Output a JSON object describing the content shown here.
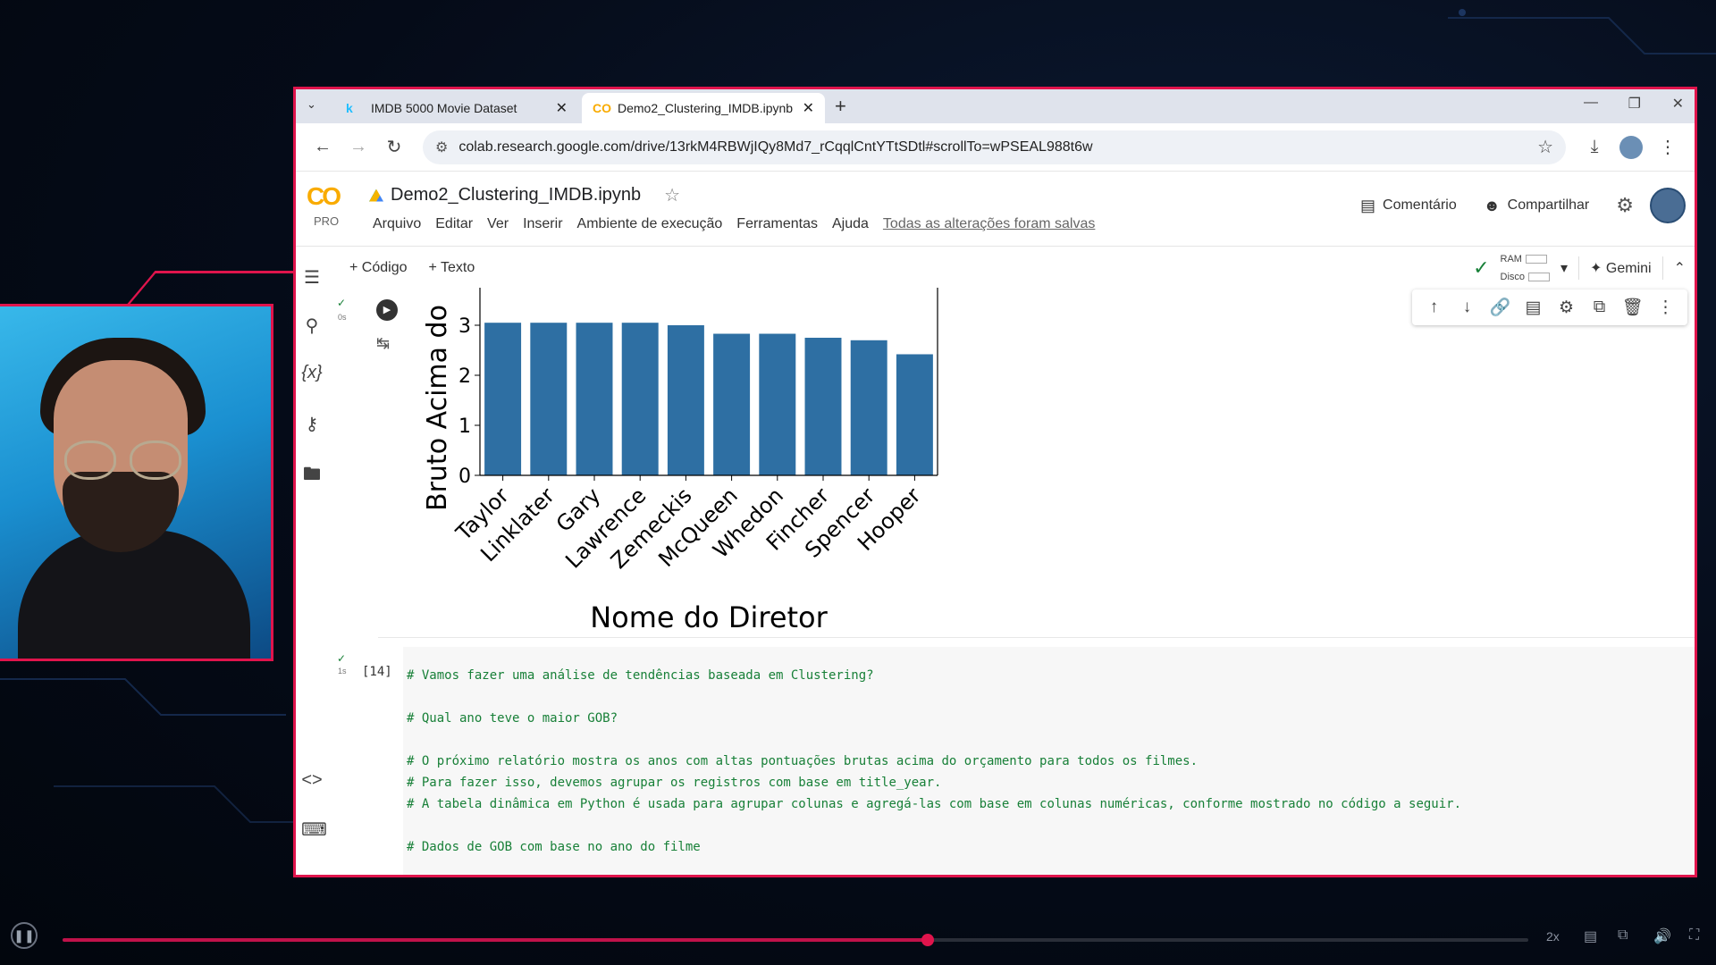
{
  "browser": {
    "tabs": [
      {
        "label": "IMDB 5000 Movie Dataset",
        "favicon": "k"
      },
      {
        "label": "Demo2_Clustering_IMDB.ipynb",
        "favicon": "CO"
      }
    ],
    "url": "colab.research.google.com/drive/13rkM4RBWjIQy8Md7_rCqqlCntYTtSDtl#scrollTo=wPSEAL988t6w"
  },
  "colab": {
    "logo": "CO",
    "plan": "PRO",
    "notebook_title": "Demo2_Clustering_IMDB.ipynb",
    "menu": [
      "Arquivo",
      "Editar",
      "Ver",
      "Inserir",
      "Ambiente de execução",
      "Ferramentas",
      "Ajuda"
    ],
    "save_status": "Todas as alterações foram salvas",
    "comment_label": "Comentário",
    "share_label": "Compartilhar",
    "add_code_label": "+ Código",
    "add_text_label": "+ Texto",
    "ram_label": "RAM",
    "disk_label": "Disco",
    "gemini_label": "Gemini"
  },
  "cell1": {
    "time": "0s"
  },
  "chart_data": {
    "type": "bar",
    "categories": [
      "Taylor",
      "Linklater",
      "Gary",
      "Lawrence",
      "Zemeckis",
      "McQueen",
      "Whedon",
      "Fincher",
      "Spencer",
      "Hooper"
    ],
    "values": [
      3.05,
      3.05,
      3.05,
      3.05,
      3.0,
      2.83,
      2.83,
      2.75,
      2.7,
      2.42
    ],
    "xlabel": "Nome do Diretor",
    "ylabel": "Bruto Acima do",
    "yticks": [
      "0",
      "1",
      "2",
      "3"
    ],
    "ylim": [
      0,
      3.1
    ],
    "bar_color": "#2e6fa3"
  },
  "cell2": {
    "exec_count": "[14]",
    "time": "1s",
    "code_lines": [
      "# Vamos fazer uma análise de tendências baseada em Clustering?",
      "",
      "# Qual ano teve o maior GOB?",
      "",
      "# O próximo relatório mostra os anos com altas pontuações brutas acima do orçamento para todos os filmes.",
      "# Para fazer isso, devemos agrupar os registros com base em title_year.",
      "# A tabela dinâmica em Python é usada para agrupar colunas e agregá-las com base em colunas numéricas, conforme mostrado no código a seguir.",
      "",
      "# Dados de GOB com base no ano do filme"
    ]
  },
  "player": {
    "progress": 0.59,
    "speed": "2x"
  }
}
